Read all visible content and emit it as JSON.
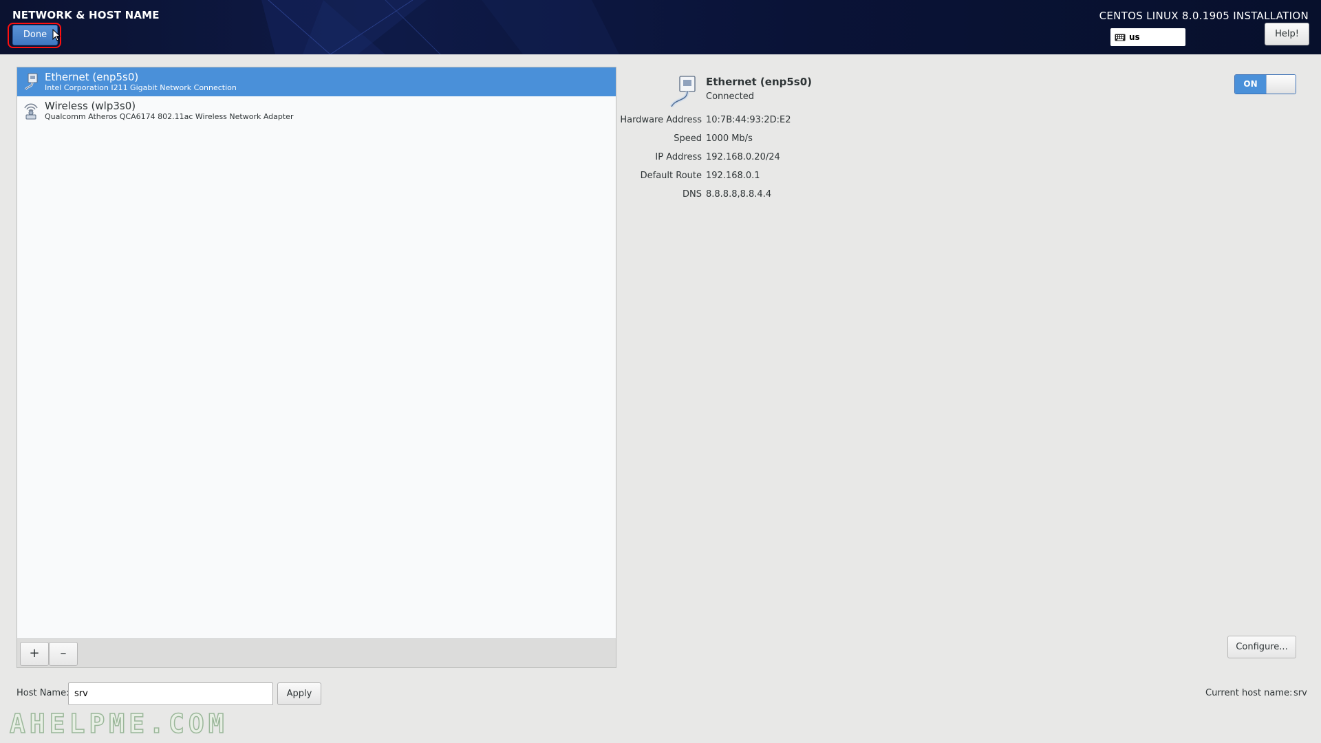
{
  "header": {
    "spoke_title": "NETWORK & HOST NAME",
    "done_label": "Done",
    "product_title": "CENTOS LINUX 8.0.1905 INSTALLATION",
    "keyboard_layout": "us",
    "help_label": "Help!",
    "colors": {
      "background": "#0e1a47",
      "done": "#4a88d0",
      "highlight": "#ff1010"
    }
  },
  "devices": [
    {
      "name": "Ethernet (enp5s0)",
      "description": "Intel Corporation I211 Gigabit Network Connection",
      "icon": "ethernet-icon",
      "selected": true
    },
    {
      "name": "Wireless (wlp3s0)",
      "description": "Qualcomm Atheros QCA6174 802.11ac Wireless Network Adapter",
      "icon": "wireless-icon",
      "selected": false
    }
  ],
  "list_toolbar": {
    "add_label": "+",
    "remove_label": "–"
  },
  "details": {
    "name": "Ethernet (enp5s0)",
    "status": "Connected",
    "icon": "ethernet-icon",
    "switch_label": "ON",
    "properties": [
      {
        "label": "Hardware Address",
        "value": "10:7B:44:93:2D:E2"
      },
      {
        "label": "Speed",
        "value": "1000 Mb/s"
      },
      {
        "label": "IP Address",
        "value": "192.168.0.20/24"
      },
      {
        "label": "Default Route",
        "value": "192.168.0.1"
      },
      {
        "label": "DNS",
        "value": "8.8.8.8,8.8.4.4"
      }
    ],
    "configure_label": "Configure..."
  },
  "hostname": {
    "label": "Host Name:",
    "value": "srv",
    "apply_label": "Apply",
    "current_label": "Current host name:",
    "current_value": "srv"
  },
  "watermark": "AHELPME.COM"
}
